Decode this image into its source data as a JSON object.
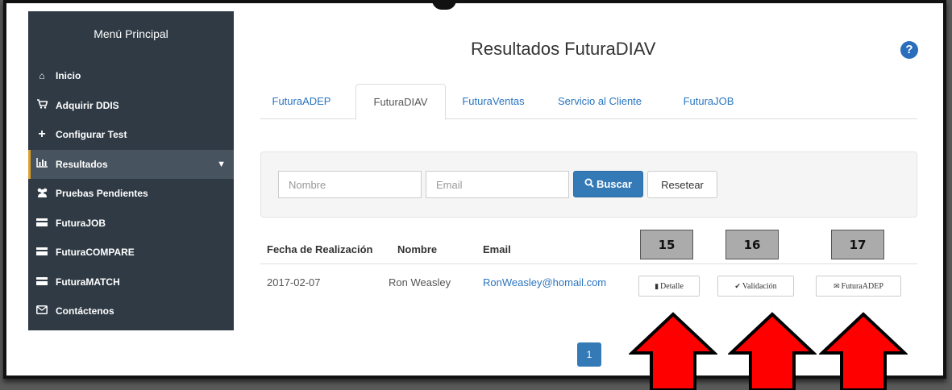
{
  "sidebar": {
    "title": "Menú Principal",
    "items": [
      {
        "label": "Inicio",
        "icon": "home-icon"
      },
      {
        "label": "Adquirir DDIS",
        "icon": "cart-icon"
      },
      {
        "label": "Configurar Test",
        "icon": "plus-icon"
      },
      {
        "label": "Resultados",
        "icon": "bar-chart-icon",
        "active": true
      },
      {
        "label": "Pruebas Pendientes",
        "icon": "users-icon"
      },
      {
        "label": "FuturaJOB",
        "icon": "list-icon"
      },
      {
        "label": "FuturaCOMPARE",
        "icon": "list-icon"
      },
      {
        "label": "FuturaMATCH",
        "icon": "list-icon"
      },
      {
        "label": "Contáctenos",
        "icon": "envelope-icon"
      }
    ]
  },
  "page": {
    "title": "Resultados FuturaDIAV",
    "help_icon": "?"
  },
  "tabs": [
    {
      "label": "FuturaADEP"
    },
    {
      "label": "FuturaDIAV",
      "active": true
    },
    {
      "label": "FuturaVentas"
    },
    {
      "label": "Servicio al Cliente"
    },
    {
      "label": "FuturaJOB"
    }
  ],
  "search": {
    "name_placeholder": "Nombre",
    "email_placeholder": "Email",
    "search_label": "Buscar",
    "reset_label": "Resetear"
  },
  "table": {
    "headers": [
      "Fecha de Realización",
      "Nombre",
      "Email"
    ],
    "rows": [
      {
        "fecha": "2017-02-07",
        "nombre": "Ron Weasley",
        "email": "RonWeasley@homail.com",
        "actions": [
          "Detalle",
          "Validación",
          "FuturaADEP"
        ]
      }
    ]
  },
  "annotations": [
    "15",
    "16",
    "17"
  ],
  "pagination": {
    "current": "1"
  },
  "colors": {
    "sidebar_bg": "#2f3a44",
    "primary": "#337ab7",
    "link": "#2a75c0",
    "arrow": "#ff0000"
  }
}
